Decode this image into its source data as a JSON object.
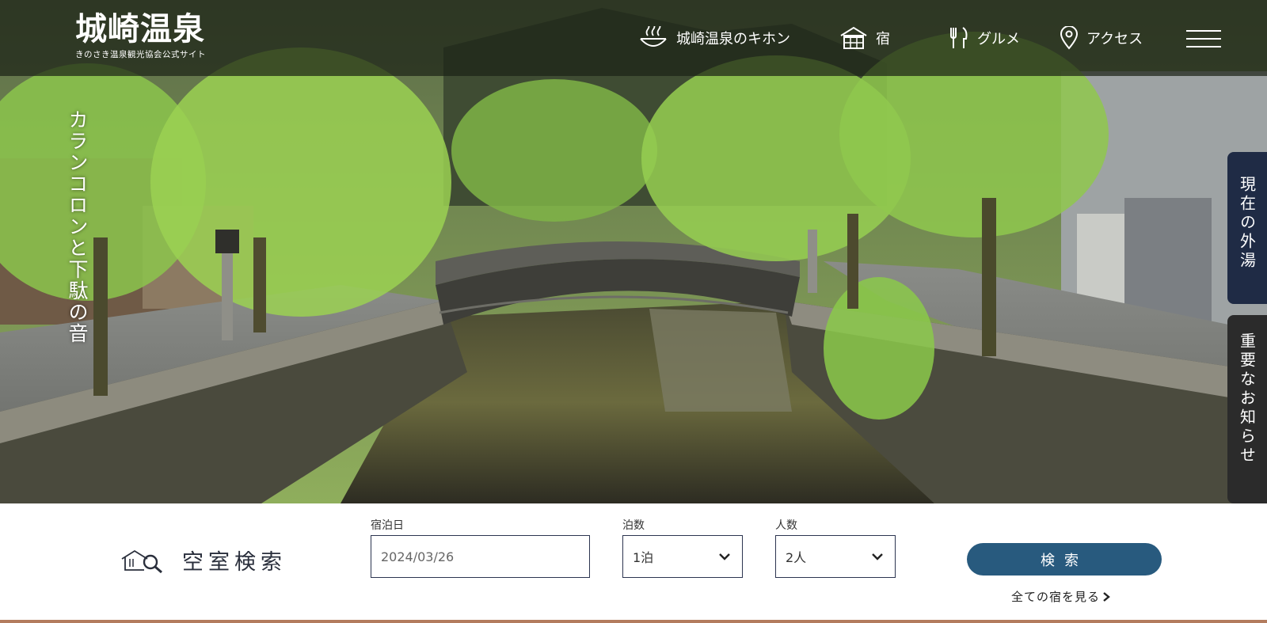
{
  "header": {
    "logo_main": "城崎温泉",
    "logo_sub": "きのさき温泉観光協会公式サイト",
    "nav": [
      {
        "label": "城崎温泉のキホン",
        "icon": "hot-spring-icon"
      },
      {
        "label": "宿",
        "icon": "inn-icon"
      },
      {
        "label": "グルメ",
        "icon": "cutlery-icon"
      },
      {
        "label": "アクセス",
        "icon": "map-pin-icon"
      }
    ],
    "menu_icon": "hamburger-menu-icon"
  },
  "hero": {
    "tagline": "カランコロンと下駄の音"
  },
  "side_tabs": {
    "outdoor_bath": "現在の外湯",
    "notice": "重要なお知らせ"
  },
  "search": {
    "title": "空室検索",
    "title_icon": "house-search-icon",
    "date_label": "宿泊日",
    "date_value": "2024/03/26",
    "nights_label": "泊数",
    "nights_value": "1泊",
    "guests_label": "人数",
    "guests_value": "2人",
    "button_label": "検索",
    "all_inns_link": "全ての宿を見る"
  },
  "colors": {
    "header_overlay": "#1c2216",
    "search_button": "#285a7e",
    "side_tab": "#1f2b45"
  }
}
